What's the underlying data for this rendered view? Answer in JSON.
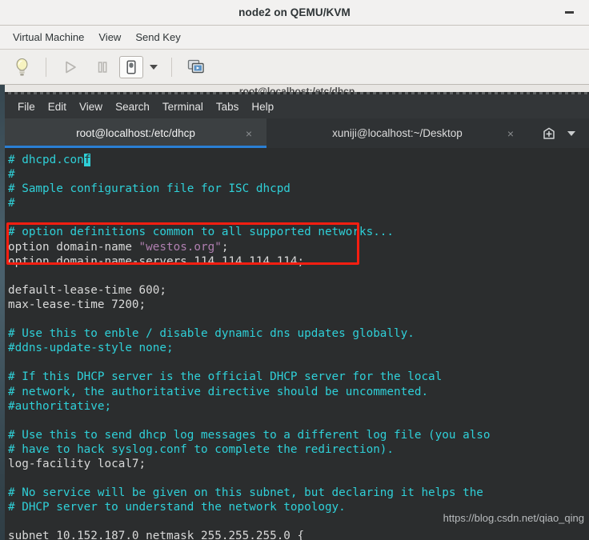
{
  "vm_window": {
    "title": "node2 on QEMU/KVM",
    "minimize_label": "–",
    "menu": [
      {
        "label": "Virtual Machine",
        "name": "menu-virtual-machine"
      },
      {
        "label": "View",
        "name": "menu-view"
      },
      {
        "label": "Send Key",
        "name": "menu-send-key"
      }
    ],
    "toolbar": [
      {
        "name": "show-details-button",
        "icon": "lightbulb-icon",
        "tooltip": "Show the graphical console"
      },
      {
        "name": "run-button",
        "icon": "play-icon",
        "tooltip": "Run"
      },
      {
        "name": "pause-button",
        "icon": "pause-icon",
        "tooltip": "Pause"
      },
      {
        "name": "shutdown-button",
        "icon": "power-icon",
        "tooltip": "Shut Down"
      },
      {
        "name": "shutdown-dropdown",
        "icon": "chevron-down-icon",
        "tooltip": "Shutdown options"
      },
      {
        "name": "fullscreen-button",
        "icon": "screens-icon",
        "tooltip": "Switch to fullscreen view"
      }
    ]
  },
  "terminal": {
    "window_title": "root@localhost:/etc/dhcp",
    "menu": [
      {
        "label": "File",
        "name": "terminal-menu-file"
      },
      {
        "label": "Edit",
        "name": "terminal-menu-edit"
      },
      {
        "label": "View",
        "name": "terminal-menu-view"
      },
      {
        "label": "Search",
        "name": "terminal-menu-search"
      },
      {
        "label": "Terminal",
        "name": "terminal-menu-terminal"
      },
      {
        "label": "Tabs",
        "name": "terminal-menu-tabs"
      },
      {
        "label": "Help",
        "name": "terminal-menu-help"
      }
    ],
    "tabs": [
      {
        "label": "root@localhost:/etc/dhcp",
        "active": true,
        "close_glyph": "×"
      },
      {
        "label": "xuniji@localhost:~/Desktop",
        "active": false,
        "close_glyph": "×"
      }
    ],
    "new_tab_icon": "new-tab-icon",
    "tab_menu_icon": "chevron-down-icon",
    "colors": {
      "background": "#2b2d2e",
      "comment": "#2fd0d8",
      "plain": "#d9d9d9",
      "string": "#b07fb0",
      "cursor": "#2fd0d8",
      "tab_active_underline": "#2a7fd4",
      "annotation_red": "#f81e11"
    },
    "lines": [
      {
        "segments": [
          {
            "t": "# dhcpd.con",
            "c": "comment"
          },
          {
            "t": "f",
            "c": "cursor"
          }
        ]
      },
      {
        "segments": [
          {
            "t": "#",
            "c": "comment"
          }
        ]
      },
      {
        "segments": [
          {
            "t": "# Sample configuration file for ISC dhcpd",
            "c": "comment"
          }
        ]
      },
      {
        "segments": [
          {
            "t": "#",
            "c": "comment"
          }
        ]
      },
      {
        "segments": [
          {
            "t": "",
            "c": "plain"
          }
        ]
      },
      {
        "segments": [
          {
            "t": "# option definitions common to all supported networks...",
            "c": "comment"
          }
        ]
      },
      {
        "segments": [
          {
            "t": "option domain-name ",
            "c": "plain"
          },
          {
            "t": "\"westos.org\"",
            "c": "string"
          },
          {
            "t": ";",
            "c": "plain"
          }
        ]
      },
      {
        "segments": [
          {
            "t": "option domain-name-servers 114.114.114.114;",
            "c": "plain"
          }
        ]
      },
      {
        "segments": [
          {
            "t": "",
            "c": "plain"
          }
        ]
      },
      {
        "segments": [
          {
            "t": "default-lease-time 600;",
            "c": "plain"
          }
        ]
      },
      {
        "segments": [
          {
            "t": "max-lease-time 7200;",
            "c": "plain"
          }
        ]
      },
      {
        "segments": [
          {
            "t": "",
            "c": "plain"
          }
        ]
      },
      {
        "segments": [
          {
            "t": "# Use this to enble / disable dynamic dns updates globally.",
            "c": "comment"
          }
        ]
      },
      {
        "segments": [
          {
            "t": "#ddns-update-style none;",
            "c": "comment"
          }
        ]
      },
      {
        "segments": [
          {
            "t": "",
            "c": "plain"
          }
        ]
      },
      {
        "segments": [
          {
            "t": "# If this DHCP server is the official DHCP server for the local",
            "c": "comment"
          }
        ]
      },
      {
        "segments": [
          {
            "t": "# network, the authoritative directive should be uncommented.",
            "c": "comment"
          }
        ]
      },
      {
        "segments": [
          {
            "t": "#authoritative;",
            "c": "comment"
          }
        ]
      },
      {
        "segments": [
          {
            "t": "",
            "c": "plain"
          }
        ]
      },
      {
        "segments": [
          {
            "t": "# Use this to send dhcp log messages to a different log file (you also",
            "c": "comment"
          }
        ]
      },
      {
        "segments": [
          {
            "t": "# have to hack syslog.conf to complete the redirection).",
            "c": "comment"
          }
        ]
      },
      {
        "segments": [
          {
            "t": "log-facility local7;",
            "c": "plain"
          }
        ]
      },
      {
        "segments": [
          {
            "t": "",
            "c": "plain"
          }
        ]
      },
      {
        "segments": [
          {
            "t": "# No service will be given on this subnet, but declaring it helps the",
            "c": "comment"
          }
        ]
      },
      {
        "segments": [
          {
            "t": "# DHCP server to understand the network topology.",
            "c": "comment"
          }
        ]
      },
      {
        "segments": [
          {
            "t": "",
            "c": "plain"
          }
        ]
      },
      {
        "segments": [
          {
            "t": "subnet 10.152.187.0 netmask 255.255.255.0 {",
            "c": "plain"
          }
        ]
      }
    ],
    "annotation": {
      "name": "red-highlight-box",
      "covers_lines": [
        "option domain-name \"westos.org\";",
        "option domain-name-servers 114.114.114.114;"
      ]
    }
  },
  "watermark": {
    "text": "https://blog.csdn.net/qiao_qing"
  }
}
